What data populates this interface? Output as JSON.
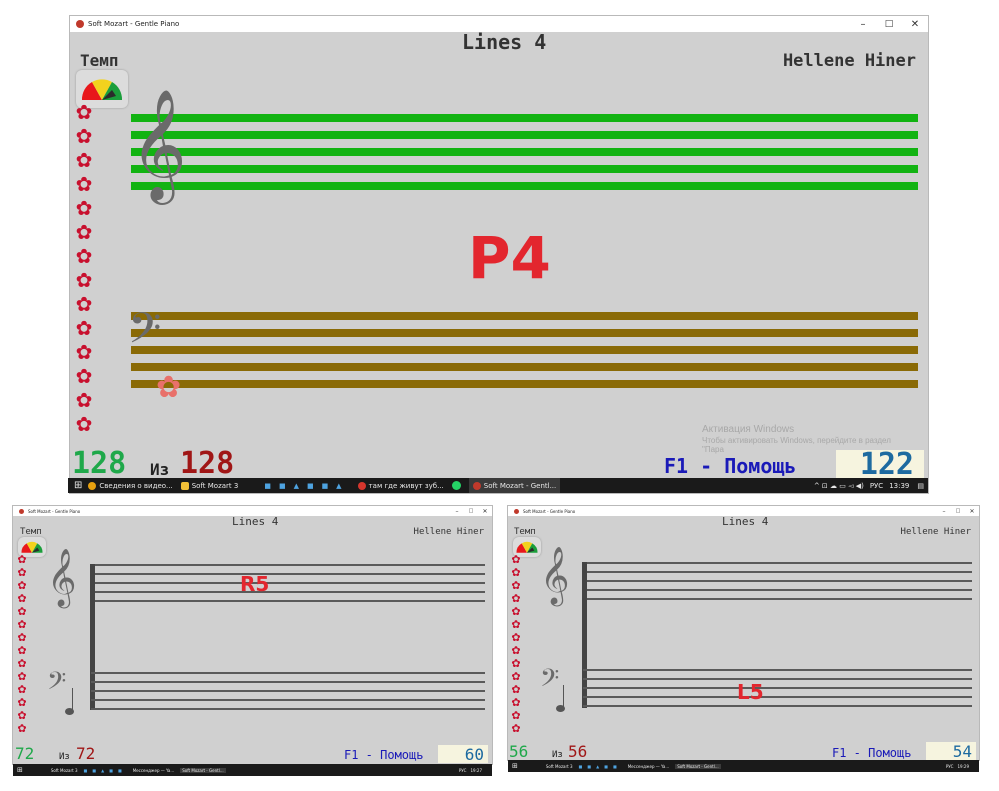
{
  "windows": [
    {
      "title": "Soft Mozart - Gentle Piano",
      "header": "Lines 4",
      "tempo_label": "Темп",
      "student": "Hellene Hiner",
      "note_label": "P4",
      "counter_left": "128",
      "counter_of": "Из",
      "counter_total": "128",
      "help": "F1 - Помощь",
      "score": "122",
      "activation_title": "Активация Windows",
      "activation_text_1": "Чтобы активировать Windows, перейдите в раздел",
      "activation_text_2": "\"Пара",
      "taskbar": {
        "items": [
          "Сведения о видео...",
          "Soft Mozart 3",
          "Soft Mozart - Gentl..."
        ],
        "extra_item": "там где живут зуб...",
        "lang": "РУС",
        "time": "13:39"
      }
    },
    {
      "title": "Soft Mozart - Gentle Piano",
      "header": "Lines 4",
      "tempo_label": "Темп",
      "student": "Hellene Hiner",
      "note_label": "R5",
      "counter_left": "72",
      "counter_of": "Из",
      "counter_total": "72",
      "help": "F1 - Помощь",
      "score": "60",
      "taskbar": {
        "items": [
          "Soft Mozart 3",
          "Мессенджер — Ya...",
          "Soft Mozart - Gentl..."
        ],
        "lang": "РУС",
        "time": "19:27"
      }
    },
    {
      "title": "Soft Mozart - Gentle Piano",
      "header": "Lines 4",
      "tempo_label": "Темп",
      "student": "Hellene Hiner",
      "note_label": "L5",
      "counter_left": "56",
      "counter_of": "Из",
      "counter_total": "56",
      "help": "F1 - Помощь",
      "score": "54",
      "taskbar": {
        "items": [
          "Soft Mozart 3",
          "Мессенджер — Ya...",
          "Soft Mozart - Gentl..."
        ],
        "lang": "РУС",
        "time": "19:29"
      }
    }
  ],
  "colors": {
    "green_staff": "#12b312",
    "brown_staff": "#8a6a06",
    "gray_staff": "#5a5a5a",
    "note_red": "#e3262e",
    "counter_green": "#1fa84a",
    "counter_red": "#a01616",
    "help_blue": "#1a1ab8",
    "score_blue": "#1d6aa0"
  },
  "icons": [
    "flower-icon",
    "treble-clef-icon",
    "bass-clef-icon",
    "tempo-gauge-icon",
    "windows-start-icon"
  ]
}
